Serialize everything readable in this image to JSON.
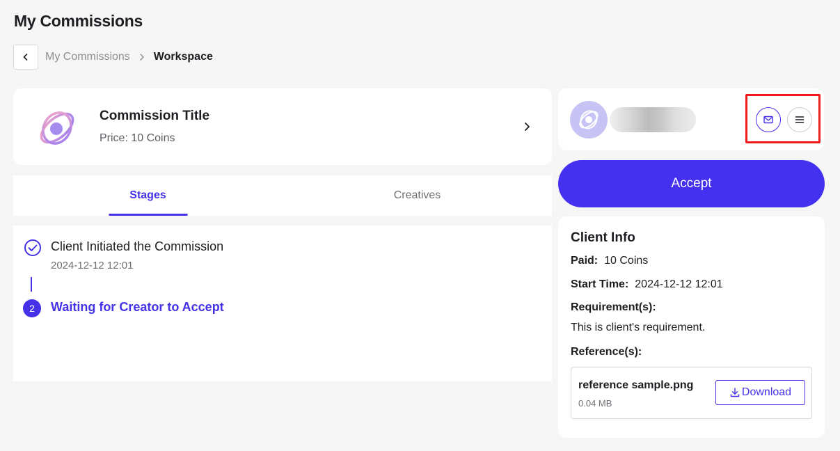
{
  "page_title": "My Commissions",
  "breadcrumb": {
    "back_icon": "chevron-left-icon",
    "previous": "My Commissions",
    "separator_icon": "chevron-right-icon",
    "current": "Workspace"
  },
  "commission": {
    "title": "Commission Title",
    "price": "Price: 10 Coins",
    "logo_icon": "atom-logo-icon"
  },
  "tabs": [
    {
      "label": "Stages",
      "active": true
    },
    {
      "label": "Creatives",
      "active": false
    }
  ],
  "stages": [
    {
      "title": "Client Initiated the Commission",
      "time": "2024-12-12 12:01",
      "status": "completed",
      "icon": "check-circle-icon"
    },
    {
      "title": "Waiting for Creator to Accept",
      "number": "2",
      "status": "current"
    }
  ],
  "user": {
    "avatar_icon": "atom-avatar-icon",
    "name": "",
    "mail_icon": "mail-icon",
    "menu_icon": "menu-icon"
  },
  "accept_label": "Accept",
  "client_info": {
    "heading": "Client Info",
    "paid_label": "Paid:",
    "paid_value": "10 Coins",
    "start_time_label": "Start Time:",
    "start_time_value": "2024-12-12 12:01",
    "requirements_label": "Requirement(s):",
    "requirements_value": "This is client's requirement.",
    "references_label": "Reference(s):",
    "reference": {
      "file_name": "reference sample.png",
      "file_size": "0.04 MB",
      "download_label": "Download",
      "download_icon": "download-icon"
    }
  },
  "colors": {
    "accent": "#4431e8",
    "highlight": "#ef1b1b",
    "background": "#f6f6f7"
  }
}
